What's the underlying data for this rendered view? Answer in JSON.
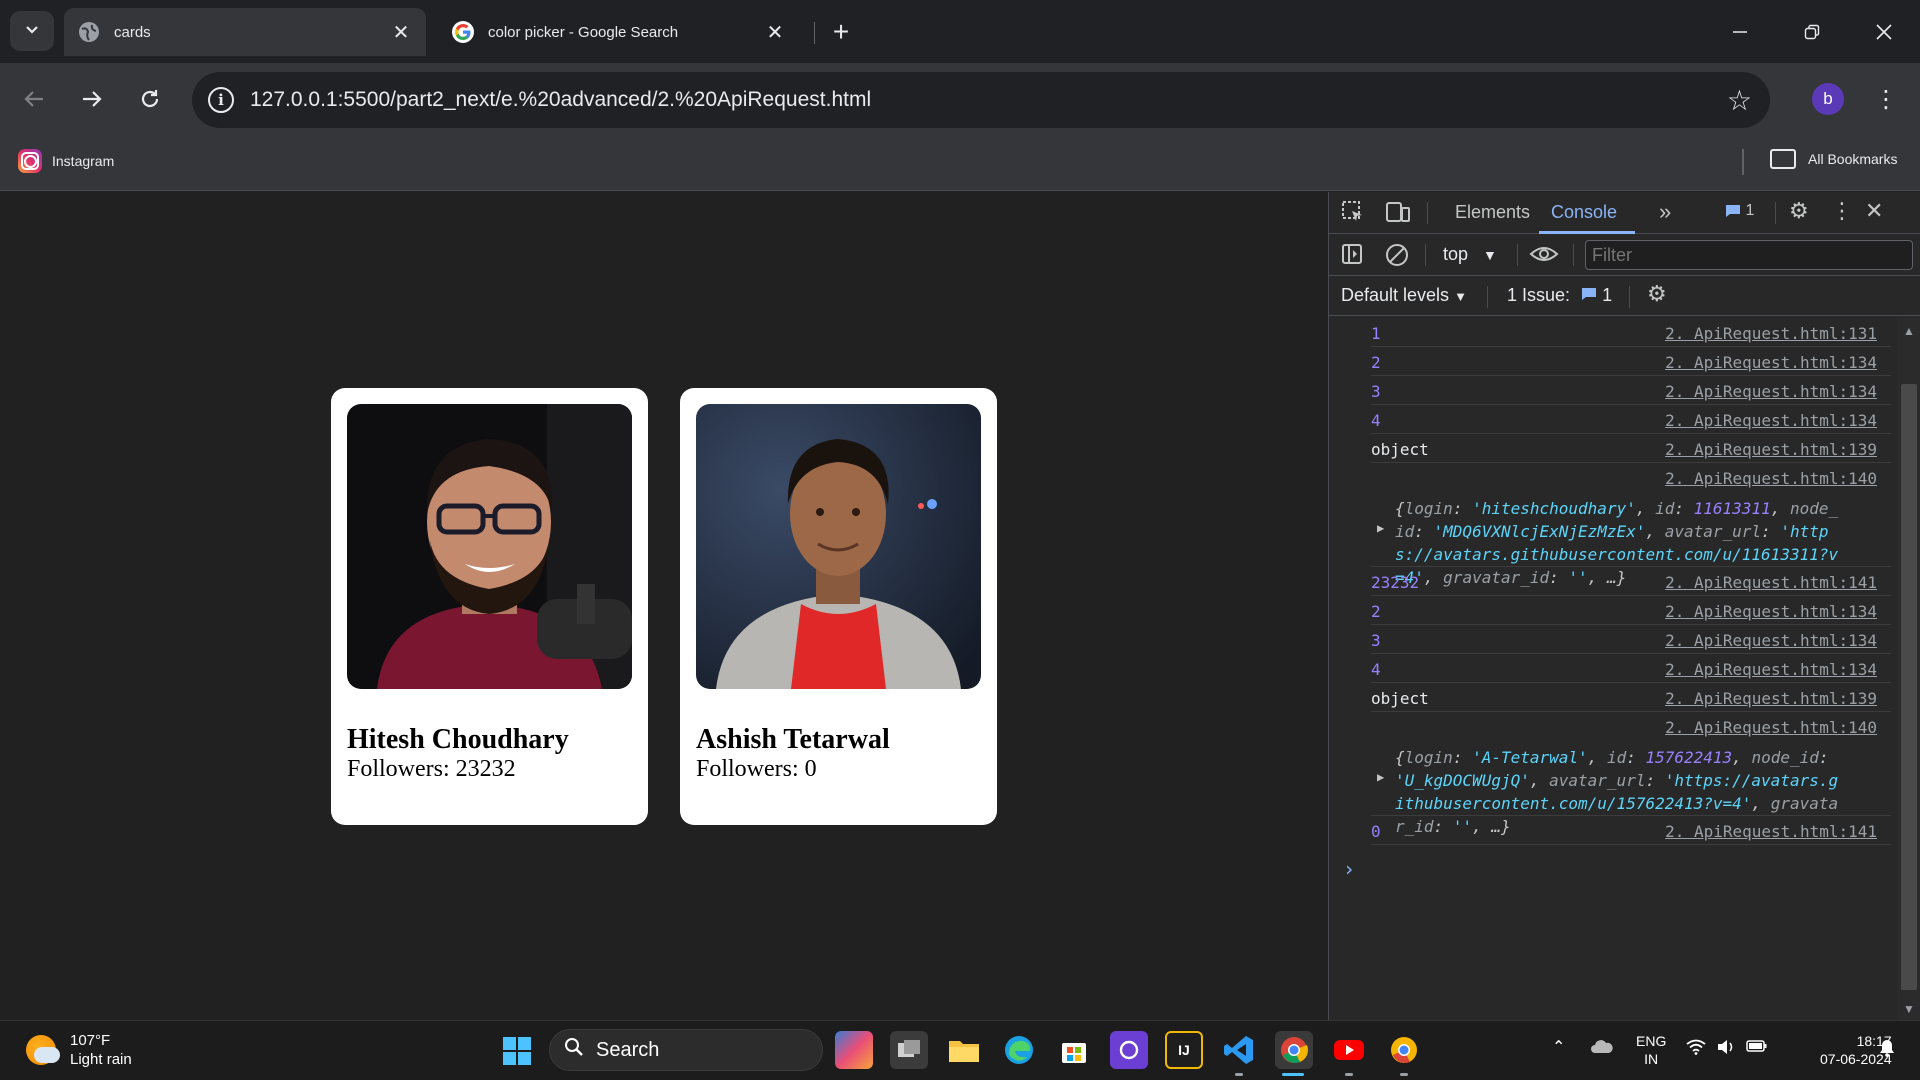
{
  "browser": {
    "tabs": [
      {
        "title": "cards",
        "active": true,
        "favicon": "globe-icon"
      },
      {
        "title": "color picker - Google Search",
        "active": false,
        "favicon": "google-icon"
      }
    ],
    "url": "127.0.0.1:5500/part2_next/e.%20advanced/2.%20ApiRequest.html",
    "profile_initial": "b",
    "bookmarks": [
      {
        "label": "Instagram",
        "icon": "instagram-icon"
      }
    ],
    "all_bookmarks_label": "All Bookmarks"
  },
  "page": {
    "cards": [
      {
        "name": "Hitesh Choudhary",
        "followers": "Followers: 23232"
      },
      {
        "name": "Ashish Tetarwal",
        "followers": "Followers: 0"
      }
    ]
  },
  "devtools": {
    "tabs": [
      "Elements",
      "Console"
    ],
    "issue_badge_count": "1",
    "context": "top",
    "filter_placeholder": "Filter",
    "levels": "Default levels",
    "issues_label": "1 Issue:",
    "issues_count": "1",
    "logs": [
      {
        "msg": "1",
        "src": "2. ApiRequest.html:131",
        "num": true
      },
      {
        "msg": "2",
        "src": "2. ApiRequest.html:134",
        "num": true
      },
      {
        "msg": "3",
        "src": "2. ApiRequest.html:134",
        "num": true
      },
      {
        "msg": "4",
        "src": "2. ApiRequest.html:134",
        "num": true
      },
      {
        "msg": "object",
        "src": "2. ApiRequest.html:139",
        "num": false
      },
      {
        "msg": "",
        "src": "2. ApiRequest.html:140",
        "num": false,
        "object": {
          "login": "'hiteshchoudhary'",
          "id": "11613311",
          "node_id": "'MDQ6VXNlcjExNjEzMzEx'",
          "avatar_url": "'https://avatars.githubusercontent.com/u/11613311?v=4'",
          "gravatar_id": "''"
        }
      },
      {
        "msg": "23232",
        "src": "2. ApiRequest.html:141",
        "num": true
      },
      {
        "msg": "2",
        "src": "2. ApiRequest.html:134",
        "num": true
      },
      {
        "msg": "3",
        "src": "2. ApiRequest.html:134",
        "num": true
      },
      {
        "msg": "4",
        "src": "2. ApiRequest.html:134",
        "num": true
      },
      {
        "msg": "object",
        "src": "2. ApiRequest.html:139",
        "num": false
      },
      {
        "msg": "",
        "src": "2. ApiRequest.html:140",
        "num": false,
        "object": {
          "login": "'A-Tetarwal'",
          "id": "157622413",
          "node_id": "'U_kgDOCWUgjQ'",
          "avatar_url": "'https://avatars.githubusercontent.com/u/157622413?v=4'",
          "gravatar_id": "''"
        }
      },
      {
        "msg": "0",
        "src": "2. ApiRequest.html:141",
        "num": true
      }
    ]
  },
  "taskbar": {
    "weather_temp": "107°F",
    "weather_desc": "Light rain",
    "search_label": "Search",
    "lang_line1": "ENG",
    "lang_line2": "IN",
    "time": "18:17",
    "date": "07-06-2024"
  }
}
